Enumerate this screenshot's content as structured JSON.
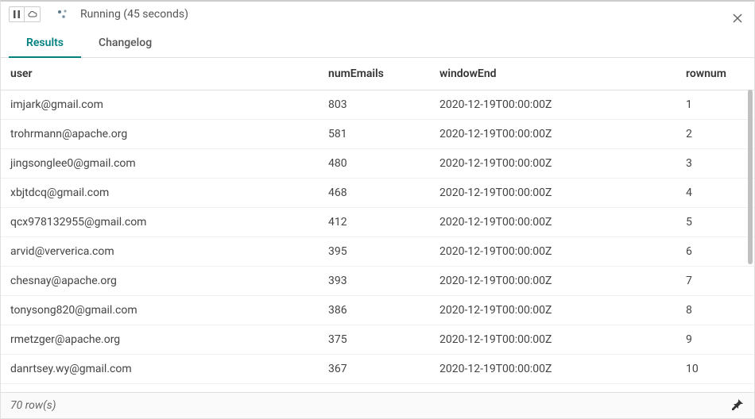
{
  "status": {
    "text": "Running (45 seconds)"
  },
  "tabs": [
    {
      "label": "Results",
      "active": true
    },
    {
      "label": "Changelog",
      "active": false
    }
  ],
  "columns": {
    "user": "user",
    "numEmails": "numEmails",
    "windowEnd": "windowEnd",
    "rownum": "rownum"
  },
  "rows": [
    {
      "user": "imjark@gmail.com",
      "numEmails": "803",
      "windowEnd": "2020-12-19T00:00:00Z",
      "rownum": "1"
    },
    {
      "user": "trohrmann@apache.org",
      "numEmails": "581",
      "windowEnd": "2020-12-19T00:00:00Z",
      "rownum": "2"
    },
    {
      "user": "jingsonglee0@gmail.com",
      "numEmails": "480",
      "windowEnd": "2020-12-19T00:00:00Z",
      "rownum": "3"
    },
    {
      "user": "xbjtdcq@gmail.com",
      "numEmails": "468",
      "windowEnd": "2020-12-19T00:00:00Z",
      "rownum": "4"
    },
    {
      "user": "qcx978132955@gmail.com",
      "numEmails": "412",
      "windowEnd": "2020-12-19T00:00:00Z",
      "rownum": "5"
    },
    {
      "user": "arvid@ververica.com",
      "numEmails": "395",
      "windowEnd": "2020-12-19T00:00:00Z",
      "rownum": "6"
    },
    {
      "user": "chesnay@apache.org",
      "numEmails": "393",
      "windowEnd": "2020-12-19T00:00:00Z",
      "rownum": "7"
    },
    {
      "user": "tonysong820@gmail.com",
      "numEmails": "386",
      "windowEnd": "2020-12-19T00:00:00Z",
      "rownum": "8"
    },
    {
      "user": "rmetzger@apache.org",
      "numEmails": "375",
      "windowEnd": "2020-12-19T00:00:00Z",
      "rownum": "9"
    },
    {
      "user": "danrtsey.wy@gmail.com",
      "numEmails": "367",
      "windowEnd": "2020-12-19T00:00:00Z",
      "rownum": "10"
    }
  ],
  "footer": {
    "rowcount_label": "70 row(s)"
  }
}
